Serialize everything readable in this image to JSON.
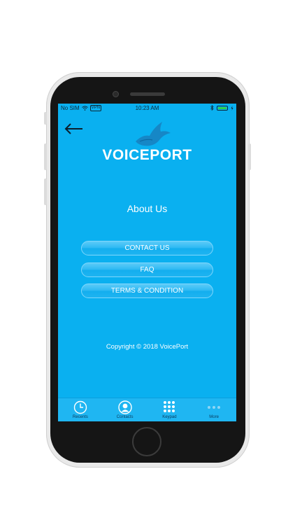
{
  "status_bar": {
    "carrier": "No SIM",
    "vpn": "VPN",
    "time": "10:23 AM"
  },
  "brand": {
    "logo_text": "VOICEPORT"
  },
  "page": {
    "title": "About Us",
    "copyright": "Copyright © 2018 VoicePort"
  },
  "menu": [
    {
      "label": "CONTACT US"
    },
    {
      "label": "FAQ"
    },
    {
      "label": "TERMS & CONDITION"
    }
  ],
  "tabs": [
    {
      "label": "Recents",
      "icon": "clock-icon"
    },
    {
      "label": "Contacts",
      "icon": "person-icon"
    },
    {
      "label": "Keypad",
      "icon": "keypad-icon"
    },
    {
      "label": "More",
      "icon": "more-icon"
    }
  ],
  "colors": {
    "screen_bg": "#0ab0f0",
    "tab_bg": "#1fb6f2",
    "battery": "#2ed04a"
  }
}
